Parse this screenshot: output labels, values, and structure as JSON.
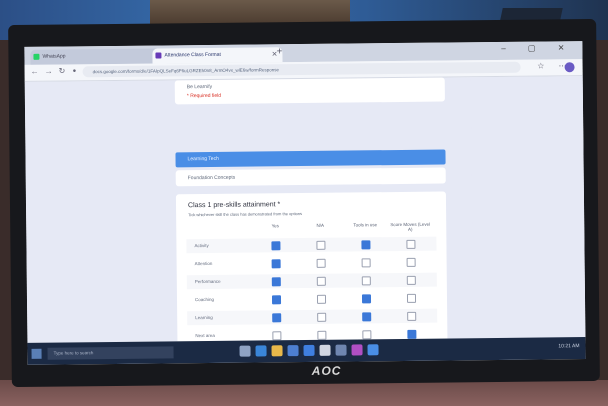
{
  "browser": {
    "tabs": [
      {
        "label": "WhatsApp",
        "active": false
      },
      {
        "label": "Attendance Class Format",
        "active": true
      }
    ],
    "url": "docs.google.com/forms/d/e/1FAIpQLSeFq6F6uLGRZEh0n8_ArmO4vx_wlE6w/formResponse",
    "new_tab_label": "+",
    "nav_icons": [
      "back-icon",
      "forward-icon",
      "reload-icon",
      "lock-icon"
    ],
    "toolbar_icons": [
      "star-icon",
      "extensions-icon",
      "profile-avatar",
      "menu-icon"
    ],
    "window_controls": "– ▢ ✕"
  },
  "form": {
    "top_card": {
      "line1": "Be Learnify",
      "line2": "* Required field"
    },
    "selected_option": "Learning Tech",
    "option_below": "Foundation Concepts",
    "question": {
      "title": "Class 1 pre-skills attainment *",
      "subtitle": "Tick whichever skill the class has demonstrated from the options",
      "columns": [
        "Yes",
        "N/A",
        "Tools in use",
        "Score Moves (Level A)"
      ],
      "rows": [
        {
          "label": "Activity",
          "checked": [
            true,
            false,
            true,
            false
          ]
        },
        {
          "label": "Attention",
          "checked": [
            true,
            false,
            false,
            false
          ]
        },
        {
          "label": "Performance",
          "checked": [
            true,
            false,
            false,
            false
          ]
        },
        {
          "label": "Coaching",
          "checked": [
            true,
            false,
            true,
            false
          ]
        },
        {
          "label": "Learning",
          "checked": [
            true,
            false,
            true,
            false
          ]
        },
        {
          "label": "Next area",
          "checked": [
            false,
            false,
            false,
            true
          ]
        }
      ]
    }
  },
  "taskbar": {
    "search_placeholder": "Type here to search",
    "icons": [
      "task-view-icon",
      "edge-icon",
      "file-explorer-icon",
      "store-icon",
      "mail-icon",
      "camera-icon",
      "cloud-icon",
      "app-icon",
      "browser-icon"
    ],
    "clock": "10:21 AM"
  },
  "monitor": {
    "brand": "AOC"
  },
  "colors": {
    "accent": "#4a8ee6",
    "checked": "#3b78d8",
    "page_bg": "#e6e9f5",
    "taskbar": "#1b2a44"
  }
}
